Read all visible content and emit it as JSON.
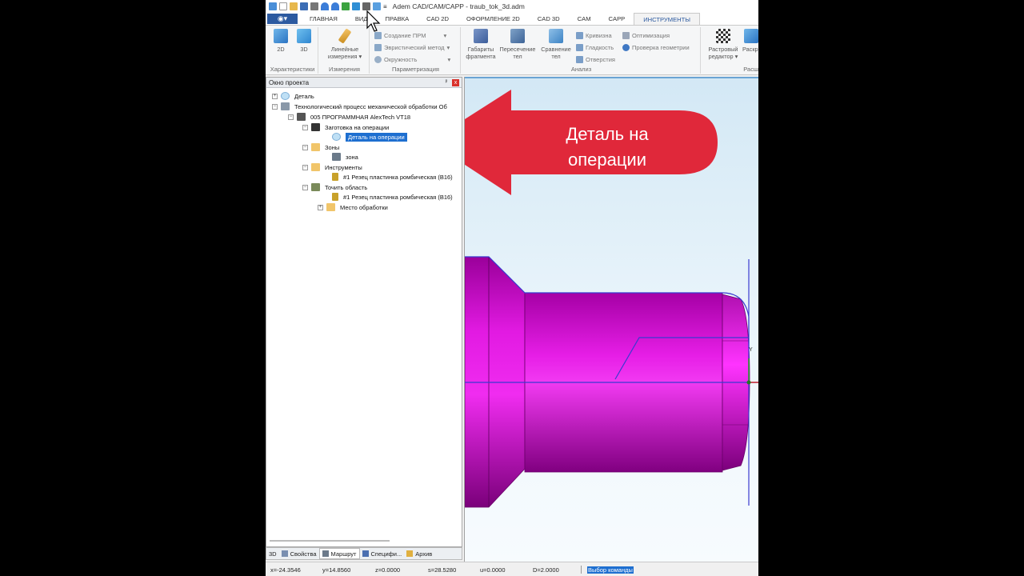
{
  "window": {
    "title": "Adem CAD/CAM/CAPP - traub_tok_3d.adm"
  },
  "menu": {
    "tabs": [
      "ГЛАВНАЯ",
      "ВИД",
      "ПРАВКА",
      "CAD 2D",
      "ОФОРМЛЕНИЕ 2D",
      "CAD 3D",
      "CAM",
      "CAPP",
      "ИНСТРУМЕНТЫ"
    ],
    "active_tab": "ИНСТРУМЕНТЫ"
  },
  "ribbon": {
    "groups": {
      "characteristics": {
        "label": "Характеристики",
        "btn_2d": "2D",
        "btn_3d": "3D"
      },
      "measurements": {
        "label": "Измерения",
        "linear_1": "Линейные",
        "linear_2": "измерения"
      },
      "parametrization": {
        "label": "Параметризация",
        "items": [
          "Создание ПРМ",
          "Эвристический метод",
          "Окружность"
        ]
      },
      "analysis": {
        "label": "Анализ",
        "gabarity_1": "Габариты",
        "gabarity_2": "фрагмента",
        "peresech_1": "Пересечение",
        "peresech_2": "тел",
        "sravn_1": "Сравнение",
        "sravn_2": "тел",
        "small": [
          "Кривизна",
          "Гладкость",
          "Отверстия"
        ],
        "small2": [
          "Оптимизация",
          "Проверка геометрии"
        ]
      },
      "raster": {
        "label": "Расш",
        "btn_1": "Растровый",
        "btn_2": "редактор",
        "btn_cut": "Раскр"
      }
    }
  },
  "panel": {
    "title": "Окно проекта",
    "pin": "ᵖ",
    "close": "x",
    "tree": [
      {
        "label": "Деталь",
        "exp": "+"
      },
      {
        "label": "Технологический процесс механической обработки  Об",
        "exp": "−"
      },
      {
        "label": "005  ПРОГРАММНАЯ AlexTech VT18",
        "exp": "−"
      },
      {
        "label": "Заготовка на операции",
        "exp": "−"
      },
      {
        "label": "Деталь на операции",
        "exp": ""
      },
      {
        "label": "Зоны",
        "exp": "−"
      },
      {
        "label": "зона",
        "exp": ""
      },
      {
        "label": "Инструменты",
        "exp": "−"
      },
      {
        "label": "#1 Резец пластинка ромбическая (В16)",
        "exp": ""
      },
      {
        "label": "Точить область",
        "exp": "−"
      },
      {
        "label": "#1 Резец пластинка ромбическая (В16)",
        "exp": ""
      },
      {
        "label": "Место обработки",
        "exp": "+"
      }
    ]
  },
  "bottom_tabs": [
    "3D",
    "Свойства",
    "Маршрут",
    "Специфи...",
    "Архив"
  ],
  "callout": {
    "line1": "Деталь на",
    "line2": "операции"
  },
  "axis": {
    "y": "Y"
  },
  "status": {
    "x": "x=-24.3546",
    "y": "y=14.8560",
    "z": "z=0.0000",
    "s": "s=28.5280",
    "u": "u=0.0000",
    "d": "D=2.0000",
    "command": "Выбор команды"
  },
  "colors": {
    "part": "#e815e8",
    "part_dark": "#8a008a",
    "outline": "#3a3ad0",
    "callout": "#e0283a",
    "selection": "#1e6fd0"
  }
}
